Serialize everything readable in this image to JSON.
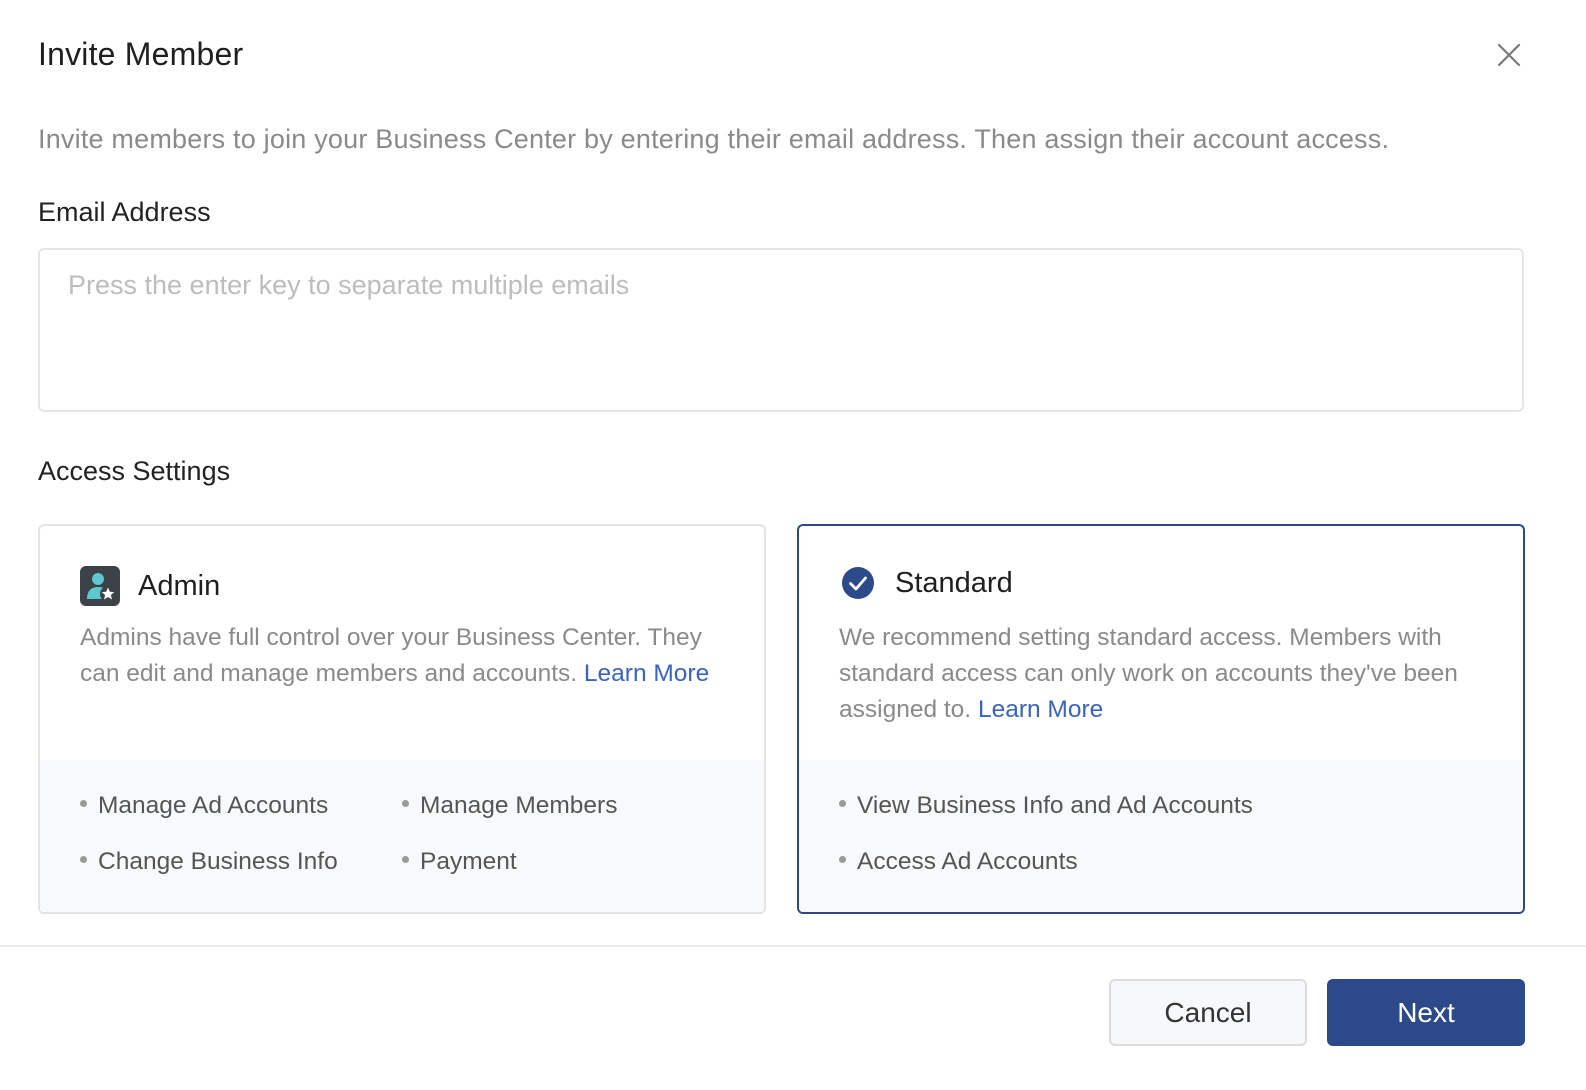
{
  "dialog": {
    "title": "Invite Member",
    "close_icon": "close-icon",
    "intro": "Invite members to join your Business Center by entering their email address. Then assign their account access."
  },
  "email": {
    "label": "Email Address",
    "placeholder": "Press the enter key to separate multiple emails",
    "value": ""
  },
  "access": {
    "label": "Access Settings",
    "selected": "Standard",
    "admin": {
      "icon": "admin-user-star-icon",
      "title": "Admin",
      "description": "Admins have full control over your Business Center. They can edit and manage members and accounts.",
      "learn_more": "Learn More",
      "permissions": [
        "Manage Ad Accounts",
        "Manage Members",
        "Change Business Info",
        "Payment"
      ]
    },
    "standard": {
      "icon": "check-circle-icon",
      "title": "Standard",
      "description": "We recommend setting standard access. Members with standard access can only work on accounts they've been assigned to.",
      "learn_more": "Learn More",
      "permissions": [
        "View Business Info and Ad Accounts",
        "Access Ad Accounts"
      ]
    }
  },
  "footer": {
    "cancel_label": "Cancel",
    "next_label": "Next"
  },
  "colors": {
    "primary": "#2c4a8a",
    "link": "#3a63c2",
    "admin_icon_bg": "#3d4148",
    "admin_icon_figure": "#5cc8cf",
    "muted_text": "#8a8a8a"
  }
}
